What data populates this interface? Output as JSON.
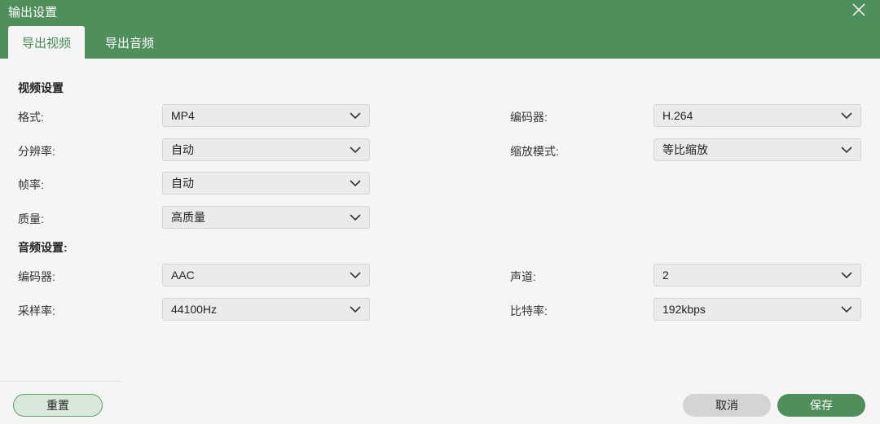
{
  "window": {
    "title": "输出设置"
  },
  "tabs": [
    {
      "label": "导出视频",
      "active": true
    },
    {
      "label": "导出音频",
      "active": false
    }
  ],
  "video_section": {
    "title": "视频设置",
    "format": {
      "label": "格式:",
      "value": "MP4"
    },
    "resolution": {
      "label": "分辨率:",
      "value": "自动"
    },
    "framerate": {
      "label": "帧率:",
      "value": "自动"
    },
    "quality": {
      "label": "质量:",
      "value": "高质量"
    },
    "encoder": {
      "label": "编码器:",
      "value": "H.264"
    },
    "zoom_mode": {
      "label": "缩放模式:",
      "value": "等比缩放"
    }
  },
  "audio_section": {
    "title": "音频设置:",
    "encoder": {
      "label": "编码器:",
      "value": "AAC"
    },
    "sample_rate": {
      "label": "采样率:",
      "value": "44100Hz"
    },
    "channels": {
      "label": "声道:",
      "value": "2"
    },
    "bitrate": {
      "label": "比特率:",
      "value": "192kbps"
    }
  },
  "footer": {
    "reset_label": "重置",
    "cancel_label": "取消",
    "save_label": "保存"
  },
  "colors": {
    "accent": "#4f8f5c",
    "background": "#f5f5f5",
    "select_bg": "#ebebeb"
  }
}
